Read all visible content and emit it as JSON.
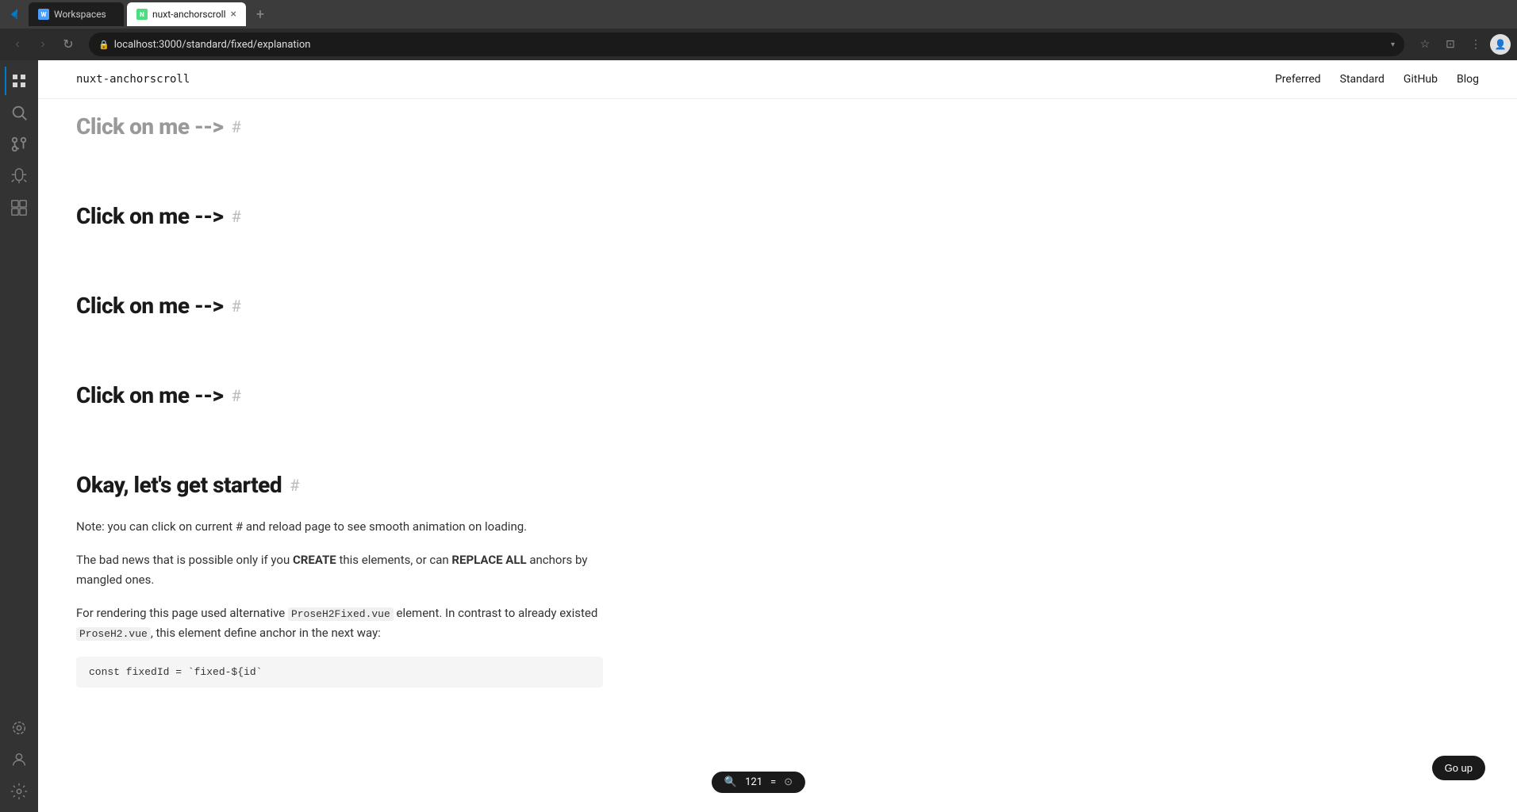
{
  "browser": {
    "tabs": [
      {
        "id": "workspaces",
        "label": "Workspaces",
        "icon": "W",
        "active": false
      },
      {
        "id": "nuxt-anchorscroll",
        "label": "nuxt-anchorscroll",
        "icon": "N",
        "active": true
      }
    ],
    "url": "localhost:3000/standard/fixed/explanation",
    "back_disabled": false,
    "forward_disabled": true
  },
  "vscode": {
    "icons": [
      {
        "id": "explorer",
        "symbol": "⊞",
        "active": true
      },
      {
        "id": "search",
        "symbol": "🔍",
        "active": false
      },
      {
        "id": "source-control",
        "symbol": "⎇",
        "active": false
      },
      {
        "id": "debug",
        "symbol": "▷",
        "active": false
      },
      {
        "id": "extensions",
        "symbol": "⊡",
        "active": false
      },
      {
        "id": "remote",
        "symbol": "⟨⟩",
        "active": false
      },
      {
        "id": "account",
        "symbol": "♟",
        "active": false
      }
    ]
  },
  "site": {
    "logo": "nuxt-anchorscroll",
    "nav": [
      {
        "id": "preferred",
        "label": "Preferred"
      },
      {
        "id": "standard",
        "label": "Standard"
      },
      {
        "id": "github",
        "label": "GitHub"
      },
      {
        "id": "blog",
        "label": "Blog"
      }
    ]
  },
  "headings": [
    {
      "id": "h1",
      "text": "Click on me -->",
      "faded": true
    },
    {
      "id": "h2",
      "text": "Click on me -->",
      "faded": false
    },
    {
      "id": "h3",
      "text": "Click on me -->",
      "faded": false
    },
    {
      "id": "h4",
      "text": "Click on me -->",
      "faded": false
    },
    {
      "id": "h5",
      "text": "Okay, let's get started",
      "faded": false
    }
  ],
  "content": {
    "note": "Note: you can click on current # and reload page to see smooth animation on loading.",
    "paragraph1": "The bad news that is possible only if you CREATE this elements, or can REPLACE ALL anchors by mangled ones.",
    "paragraph2": "For rendering this page used alternative ProseH2Fixed.vue element. In contrast to already existed ProseH2.vue, this element define anchor in the next way:",
    "code": "const fixedId = `fixed-${id`"
  },
  "zoom": {
    "level": "121",
    "unit": "="
  },
  "go_up": "Go up"
}
